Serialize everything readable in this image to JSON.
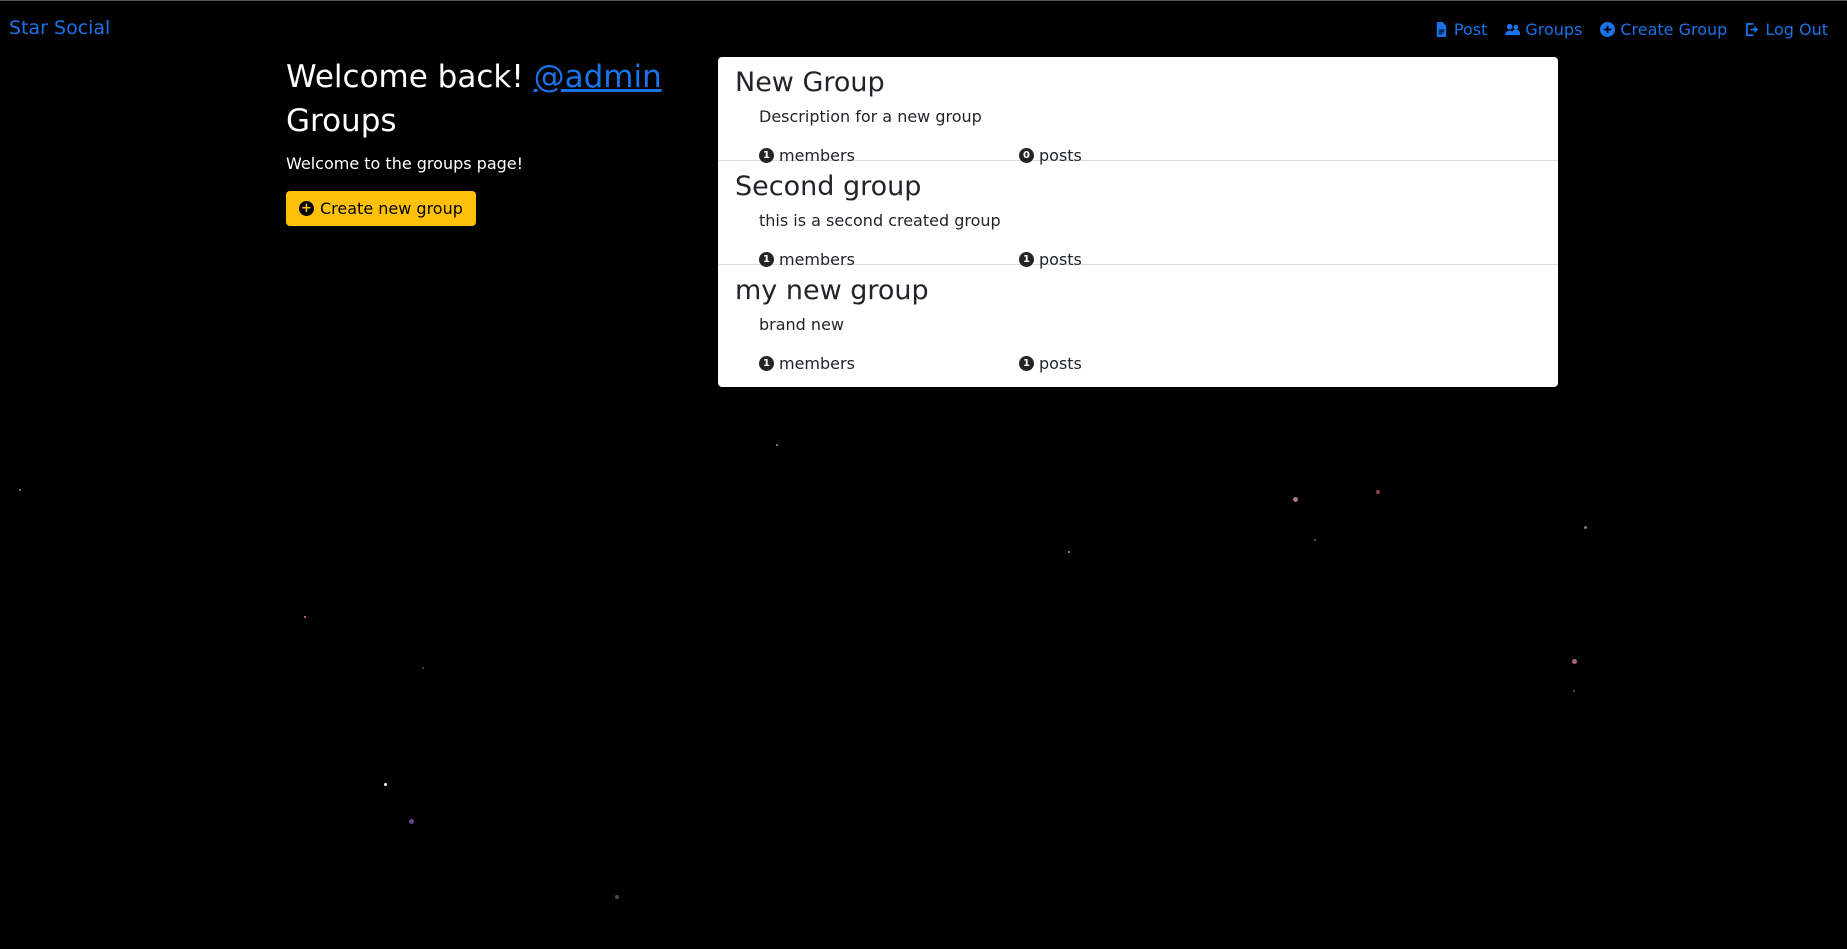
{
  "navbar": {
    "brand": "Star Social",
    "links": [
      {
        "label": "Post",
        "icon": "file-icon"
      },
      {
        "label": "Groups",
        "icon": "users-icon"
      },
      {
        "label": "Create Group",
        "icon": "plus-circle-icon"
      },
      {
        "label": "Log Out",
        "icon": "logout-icon"
      }
    ]
  },
  "sidebar": {
    "welcome_prefix": "Welcome back!",
    "username": "@admin",
    "title": "Groups",
    "subtitle": "Welcome to the groups page!",
    "create_button": "Create new group"
  },
  "groups": [
    {
      "name": "New Group",
      "description": "Description for a new group",
      "members_count": "1",
      "members_label": "members",
      "posts_count": "0",
      "posts_label": "posts"
    },
    {
      "name": "Second group",
      "description": "this is a second created group",
      "members_count": "1",
      "members_label": "members",
      "posts_count": "1",
      "posts_label": "posts"
    },
    {
      "name": "my new group",
      "description": "brand new",
      "members_count": "1",
      "members_label": "members",
      "posts_count": "1",
      "posts_label": "posts"
    }
  ],
  "colors": {
    "background": "#000000",
    "link": "#1a73e8",
    "button": "#ffc107"
  }
}
